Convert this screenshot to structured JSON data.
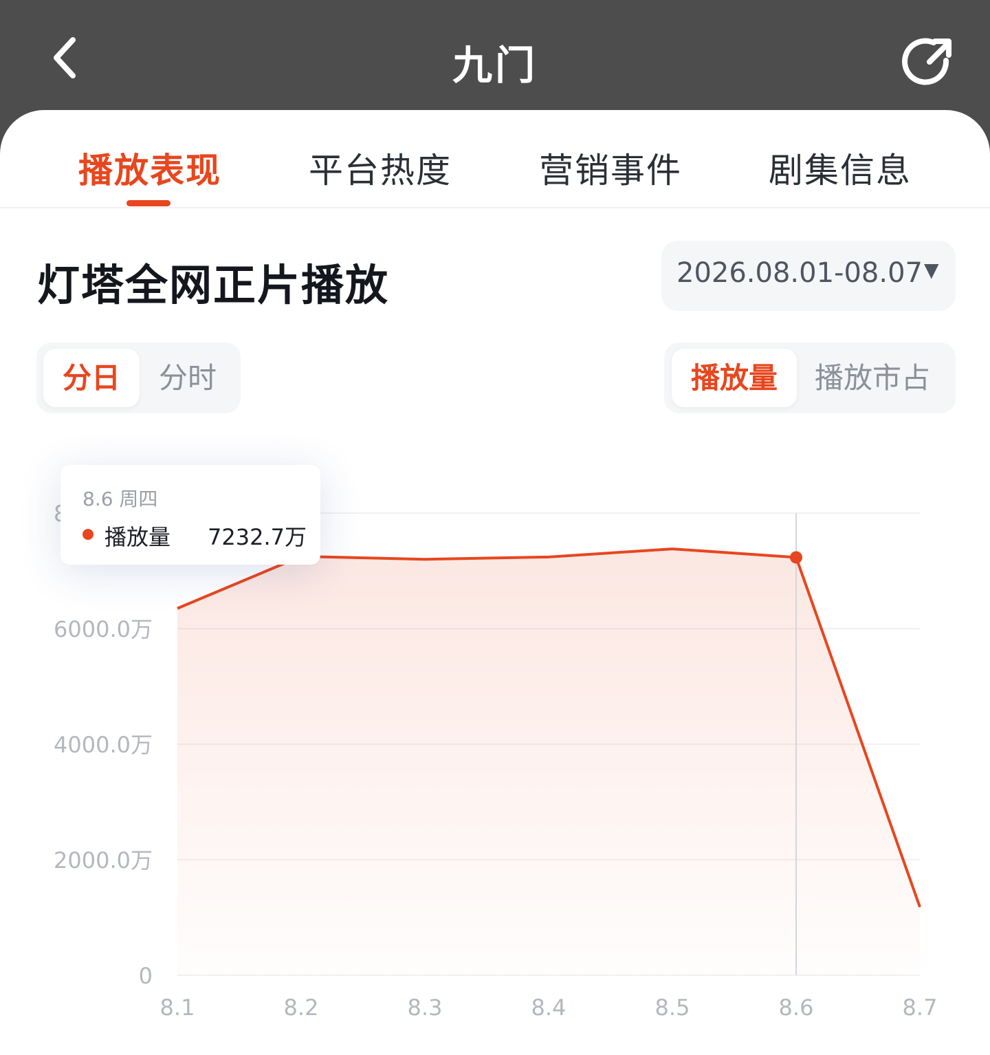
{
  "header": {
    "title": "九门",
    "back_icon": "chevron-left-icon",
    "share_icon": "share-arrow-icon"
  },
  "tabs": [
    {
      "label": "播放表现",
      "active": true
    },
    {
      "label": "平台热度",
      "active": false
    },
    {
      "label": "营销事件",
      "active": false
    },
    {
      "label": "剧集信息",
      "active": false
    }
  ],
  "section": {
    "title": "灯塔全网正片播放",
    "date_range": "2026.08.01-08.07",
    "date_caret": "▼"
  },
  "granularity": {
    "options": [
      "分日",
      "分时"
    ],
    "selected": "分日"
  },
  "metric": {
    "options": [
      "播放量",
      "播放市占"
    ],
    "selected": "播放量"
  },
  "tooltip": {
    "date": "8.6  周四",
    "label": "播放量",
    "value": "7232.7万"
  },
  "colors": {
    "accent": "#e8461e",
    "header_bg": "#4d4d4d",
    "axis_text": "#b3b7be",
    "grid": "#f0f1f4"
  },
  "chart_data": {
    "type": "area",
    "categories": [
      "8.1",
      "8.2",
      "8.3",
      "8.4",
      "8.5",
      "8.6",
      "8.7"
    ],
    "series": [
      {
        "name": "播放量",
        "values": [
          6350,
          7250,
          7200,
          7240,
          7380,
          7232.7,
          1180
        ]
      }
    ],
    "y_ticks": [
      0,
      2000,
      4000,
      6000,
      8000
    ],
    "y_tick_labels": [
      "0",
      "2000.0万",
      "4000.0万",
      "6000.0万",
      "8000.0万"
    ],
    "ylim": [
      0,
      8000
    ],
    "highlight_index": 5,
    "grid": true
  }
}
